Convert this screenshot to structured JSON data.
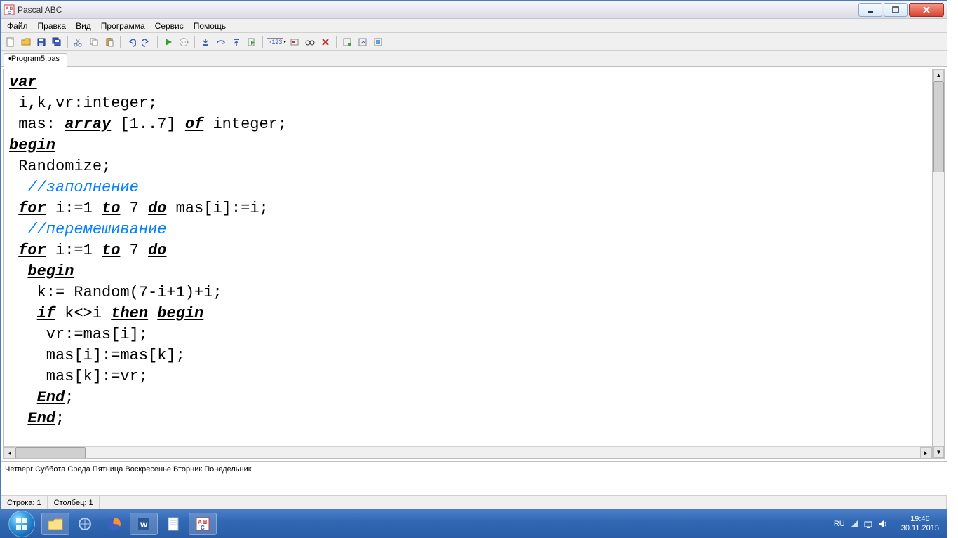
{
  "window": {
    "title": "Pascal ABC"
  },
  "menu": {
    "items": [
      "Файл",
      "Правка",
      "Вид",
      "Программа",
      "Сервис",
      "Помощь"
    ]
  },
  "tab": {
    "label": "•Program5.pas"
  },
  "code": {
    "lines": [
      {
        "indent": 0,
        "spans": [
          {
            "t": "var",
            "cls": "kw"
          }
        ]
      },
      {
        "indent": 1,
        "spans": [
          {
            "t": "i,k,vr:integer;"
          }
        ]
      },
      {
        "indent": 1,
        "spans": [
          {
            "t": "mas: "
          },
          {
            "t": "array",
            "cls": "kw"
          },
          {
            "t": " [1..7] "
          },
          {
            "t": "of",
            "cls": "kw"
          },
          {
            "t": " integer;"
          }
        ]
      },
      {
        "indent": 0,
        "spans": [
          {
            "t": "begin",
            "cls": "kw"
          }
        ]
      },
      {
        "indent": 1,
        "spans": [
          {
            "t": "Randomize;"
          }
        ]
      },
      {
        "indent": 2,
        "spans": [
          {
            "t": "//заполнение",
            "cls": "cm"
          }
        ]
      },
      {
        "indent": 1,
        "spans": [
          {
            "t": "for",
            "cls": "kw"
          },
          {
            "t": " i:=1 "
          },
          {
            "t": "to",
            "cls": "kw"
          },
          {
            "t": " 7 "
          },
          {
            "t": "do",
            "cls": "kw"
          },
          {
            "t": " mas[i]:=i;"
          }
        ]
      },
      {
        "indent": 2,
        "spans": [
          {
            "t": "//перемешивание",
            "cls": "cm"
          }
        ]
      },
      {
        "indent": 1,
        "spans": [
          {
            "t": "for",
            "cls": "kw"
          },
          {
            "t": " i:=1 "
          },
          {
            "t": "to",
            "cls": "kw"
          },
          {
            "t": " 7 "
          },
          {
            "t": "do",
            "cls": "kw"
          }
        ]
      },
      {
        "indent": 2,
        "spans": [
          {
            "t": "begin",
            "cls": "kw"
          }
        ]
      },
      {
        "indent": 3,
        "spans": [
          {
            "t": "k:= Random(7-i+1)+i;"
          }
        ]
      },
      {
        "indent": 3,
        "spans": [
          {
            "t": "if",
            "cls": "kw"
          },
          {
            "t": " k<>i "
          },
          {
            "t": "then",
            "cls": "kw"
          },
          {
            "t": " "
          },
          {
            "t": "begin",
            "cls": "kw"
          }
        ]
      },
      {
        "indent": 4,
        "spans": [
          {
            "t": "vr:=mas[i];"
          }
        ]
      },
      {
        "indent": 4,
        "spans": [
          {
            "t": "mas[i]:=mas[k];"
          }
        ]
      },
      {
        "indent": 4,
        "spans": [
          {
            "t": "mas[k]:=vr;"
          }
        ]
      },
      {
        "indent": 3,
        "spans": [
          {
            "t": "End",
            "cls": "kw"
          },
          {
            "t": ";"
          }
        ]
      },
      {
        "indent": 2,
        "spans": [
          {
            "t": "End",
            "cls": "kw"
          },
          {
            "t": ";"
          }
        ]
      }
    ]
  },
  "output": {
    "text": "Четверг Суббота Среда Пятница Воскресенье Вторник Понедельник"
  },
  "status": {
    "line": "Строка: 1",
    "col": "Столбец: 1"
  },
  "tray": {
    "lang": "RU",
    "time": "19:46",
    "date": "30.11.2015"
  }
}
